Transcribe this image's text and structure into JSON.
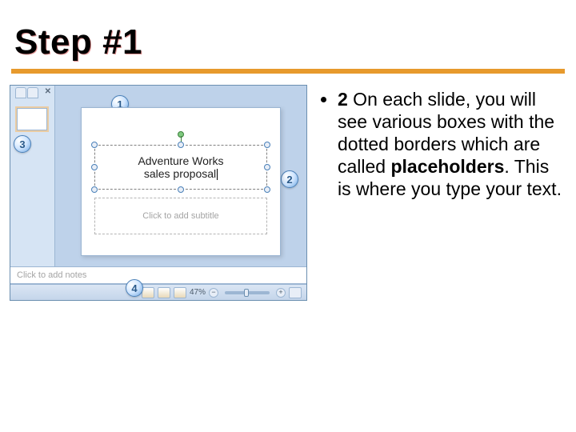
{
  "heading": "Step #1",
  "bullet": {
    "lead": "2",
    "pre": " On each slide, you will see various boxes with the dotted borders which are called ",
    "bold": "placeholders",
    "post": ". This is where you type your text."
  },
  "ppt": {
    "title_line1": "Adventure Works",
    "title_line2": "sales proposal",
    "subtitle_placeholder": "Click to add subtitle",
    "notes_placeholder": "Click to add notes",
    "zoom_label": "47%",
    "callouts": {
      "c1": "1",
      "c2": "2",
      "c3": "3",
      "c4": "4"
    }
  }
}
